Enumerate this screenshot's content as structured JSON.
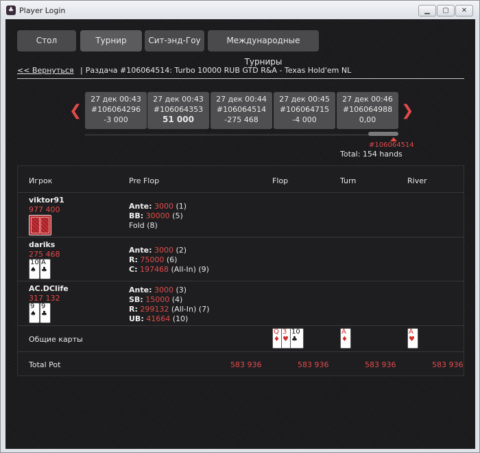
{
  "window": {
    "title": "Player Login",
    "icon": "app-logo-icon"
  },
  "tabs": [
    {
      "label": "Стол"
    },
    {
      "label": "Турнир"
    },
    {
      "label": "Сит-энд-Гоу"
    },
    {
      "label": "Международные Турниры"
    }
  ],
  "breadcrumb": {
    "back": "<< Вернуться",
    "separator": "|",
    "text": "Раздача #106064514:  Turbo 10000 RUB GTD R&A - Texas Hold'em NL"
  },
  "hands": [
    {
      "date": "27 дек 00:43",
      "id": "#106064296",
      "result": "-3 000",
      "bold": false
    },
    {
      "date": "27 дек 00:43",
      "id": "#106064353",
      "result": "51 000",
      "bold": true
    },
    {
      "date": "27 дек 00:44",
      "id": "#106064514",
      "result": "-275 468",
      "bold": false
    },
    {
      "date": "27 дек 00:45",
      "id": "#106064715",
      "result": "-4 000",
      "bold": false
    },
    {
      "date": "27 дек 00:46",
      "id": "#106064988",
      "result": "0,00",
      "bold": false
    }
  ],
  "nav": {
    "prev": "❮",
    "next": "❯"
  },
  "current_hand_id": "#106064514",
  "total_hands": "Total: 154 hands",
  "table": {
    "headers": {
      "player": "Игрок",
      "preflop": "Pre Flop",
      "flop": "Flop",
      "turn": "Turn",
      "river": "River"
    },
    "players": [
      {
        "name": "viktor91",
        "stack": "977 400",
        "cards_hidden": true,
        "actions": [
          {
            "label": "Ante:",
            "amount": "3000",
            "extra": "",
            "order": "(1)"
          },
          {
            "label": "BB:",
            "amount": "30000",
            "extra": "",
            "order": "(5)"
          },
          {
            "label": "Fold",
            "amount": "",
            "extra": "",
            "order": "(8)"
          }
        ]
      },
      {
        "name": "dariks",
        "stack": "275 468",
        "cards": [
          {
            "rank": "10",
            "suit": "♠",
            "red": false
          },
          {
            "rank": "A",
            "suit": "♣",
            "red": false
          }
        ],
        "actions": [
          {
            "label": "Ante:",
            "amount": "3000",
            "extra": "",
            "order": "(2)"
          },
          {
            "label": "R:",
            "amount": "75000",
            "extra": "",
            "order": "(6)"
          },
          {
            "label": "C:",
            "amount": "197468",
            "extra": "(All-In)",
            "order": "(9)"
          }
        ]
      },
      {
        "name": "AC.DClife",
        "stack": "317 132",
        "cards": [
          {
            "rank": "9",
            "suit": "♠",
            "red": false
          },
          {
            "rank": "9",
            "suit": "♣",
            "red": false
          }
        ],
        "actions": [
          {
            "label": "Ante:",
            "amount": "3000",
            "extra": "",
            "order": "(3)"
          },
          {
            "label": "SB:",
            "amount": "15000",
            "extra": "",
            "order": "(4)"
          },
          {
            "label": "R:",
            "amount": "299132",
            "extra": "(All-In)",
            "order": "(7)"
          },
          {
            "label": "UB:",
            "amount": "41664",
            "extra": "",
            "order": "(10)"
          }
        ]
      }
    ],
    "community": {
      "label": "Общие карты",
      "flop": [
        {
          "rank": "Q",
          "suit": "♦",
          "red": true
        },
        {
          "rank": "3",
          "suit": "♥",
          "red": true
        },
        {
          "rank": "10",
          "suit": "♣",
          "red": false
        }
      ],
      "turn": [
        {
          "rank": "A",
          "suit": "♦",
          "red": true
        }
      ],
      "river": [
        {
          "rank": "A",
          "suit": "♥",
          "red": true
        }
      ]
    },
    "total_pot": {
      "label": "Total Pot",
      "preflop": "583 936",
      "flop": "583 936",
      "turn": "583 936",
      "river": "583 936"
    }
  },
  "colors": {
    "accent": "#e34a4a",
    "background": "#1a1a1c",
    "tab": "#4a4a4c"
  }
}
